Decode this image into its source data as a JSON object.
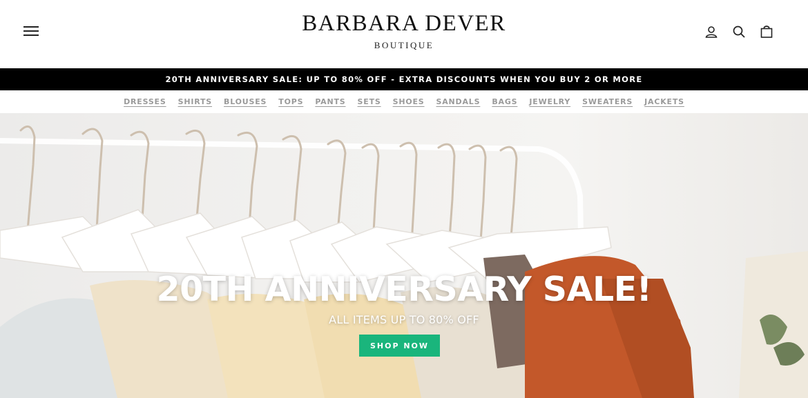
{
  "brand": {
    "title": "BARBARA DEVER",
    "subtitle": "BOUTIQUE"
  },
  "header": {
    "menu_icon": "hamburger-menu-icon",
    "icons": [
      "account-icon",
      "search-icon",
      "cart-icon"
    ]
  },
  "promo": {
    "text": "20TH ANNIVERSARY SALE: UP TO 80% OFF - EXTRA DISCOUNTS WHEN YOU BUY 2 OR MORE"
  },
  "nav": {
    "items": [
      {
        "label": "DRESSES"
      },
      {
        "label": "SHIRTS"
      },
      {
        "label": "BLOUSES"
      },
      {
        "label": "TOPS"
      },
      {
        "label": "PANTS"
      },
      {
        "label": "SETS"
      },
      {
        "label": "SHOES"
      },
      {
        "label": "SANDALS"
      },
      {
        "label": "BAGS"
      },
      {
        "label": "JEWELRY"
      },
      {
        "label": "SWEATERS"
      },
      {
        "label": "JACKETS"
      }
    ]
  },
  "hero": {
    "title": "20TH ANNIVERSARY SALE!",
    "subtitle": "ALL ITEMS UP TO 80% OFF",
    "cta_label": "SHOP NOW"
  },
  "colors": {
    "promo_bg": "#000000",
    "cta_bg": "#1ab57c",
    "nav_text": "#9a9a9a"
  }
}
